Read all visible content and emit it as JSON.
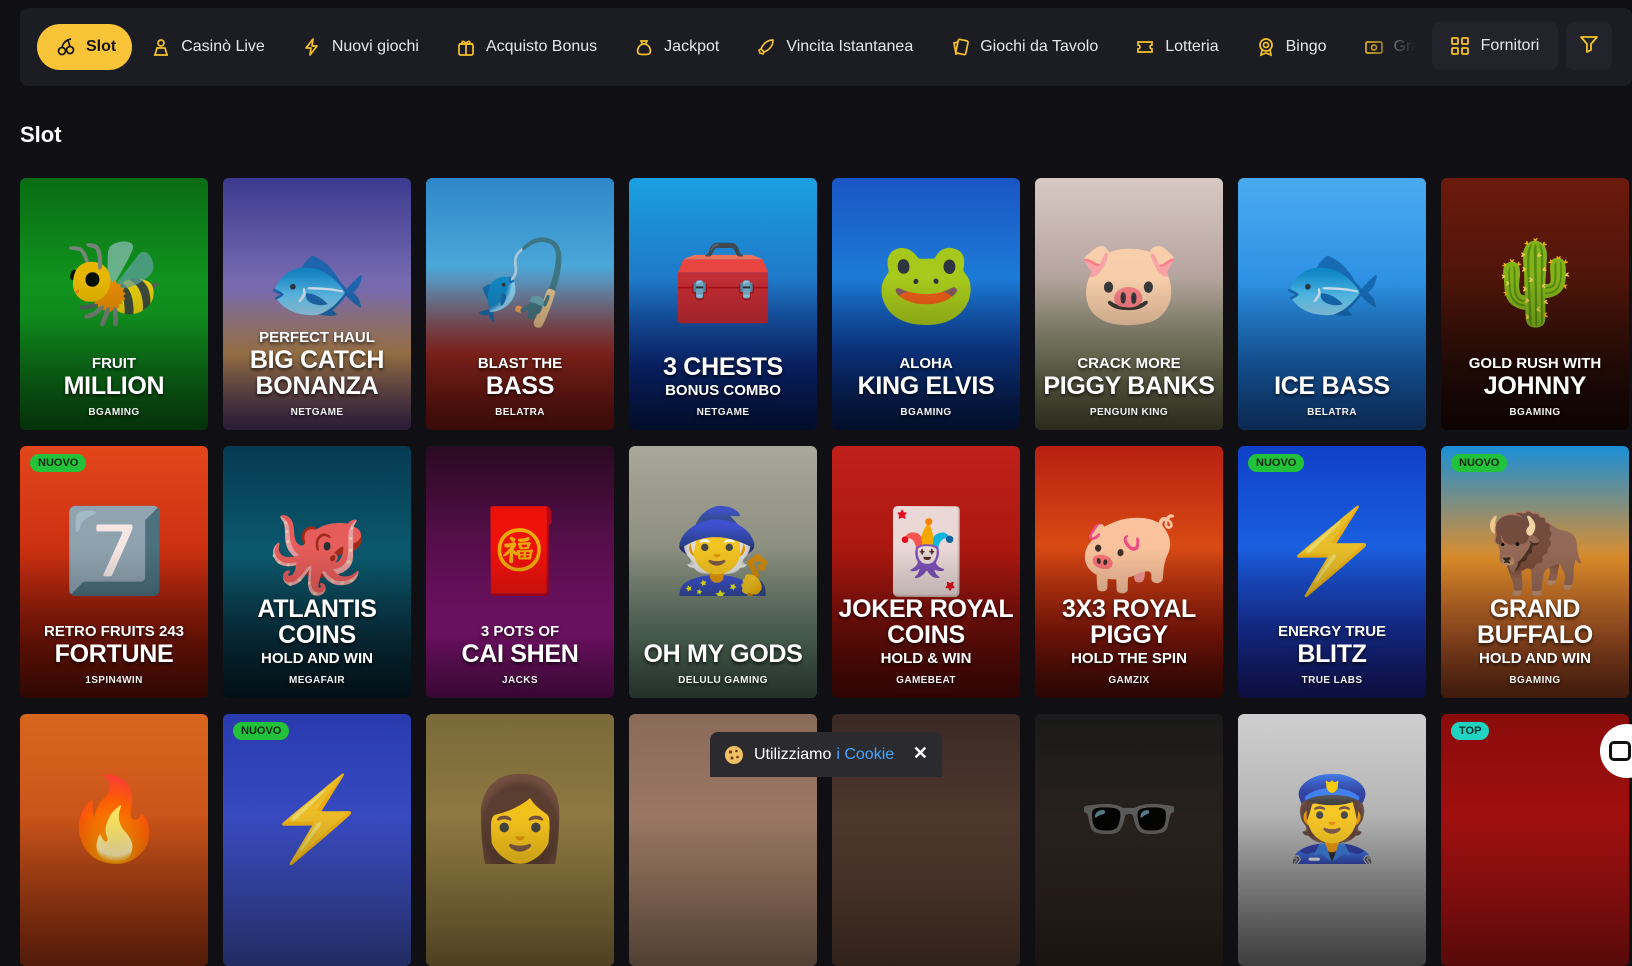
{
  "nav": {
    "items": [
      {
        "label": "Slot",
        "icon": "cherries-icon",
        "active": true
      },
      {
        "label": "Casinò Live",
        "icon": "croupier-icon"
      },
      {
        "label": "Nuovi giochi",
        "icon": "lightning-icon"
      },
      {
        "label": "Acquisto Bonus",
        "icon": "gift-icon"
      },
      {
        "label": "Jackpot",
        "icon": "money-bag-icon"
      },
      {
        "label": "Vincita Istantanea",
        "icon": "rocket-icon"
      },
      {
        "label": "Giochi da Tavolo",
        "icon": "cards-icon"
      },
      {
        "label": "Lotteria",
        "icon": "ticket-icon"
      },
      {
        "label": "Bingo",
        "icon": "bingo-icon"
      },
      {
        "label": "Gratta e Vinci",
        "icon": "scratch-card-icon"
      }
    ],
    "providers_label": "Fornitori",
    "filter_icon": "filter-icon"
  },
  "section_title": "Slot",
  "games": [
    {
      "sub": "FRUIT",
      "main": "MILLION",
      "tag": "",
      "provider": "BGAMING",
      "badge": "",
      "art": "🐝",
      "bg": "linear-gradient(180deg,#0a6c14,#12a021 55%,#0b6c17)"
    },
    {
      "sub": "PERFECT HAUL",
      "main": "BIG CATCH BONANZA",
      "tag": "",
      "provider": "NETGAME",
      "badge": "",
      "art": "🐟",
      "bg": "linear-gradient(180deg,#3b3a8f,#7d6fb4 45%,#c9955a 70%,#5d3d7a)"
    },
    {
      "sub": "BLAST THE",
      "main": "BASS",
      "tag": "",
      "provider": "BELATRA",
      "badge": "",
      "art": "🎣",
      "bg": "linear-gradient(180deg,#2f86c9,#4aa7d8 35%,#a52b22 70%,#7c1813)"
    },
    {
      "sub": "",
      "main": "3 CHESTS",
      "tag": "BONUS COMBO",
      "provider": "NETGAME",
      "badge": "",
      "art": "🧰",
      "bg": "linear-gradient(180deg,#1aa0e0,#1f79c9 40%,#0c2d8a 75%,#061c5c)"
    },
    {
      "sub": "ALOHA",
      "main": "KING ELVIS",
      "tag": "",
      "provider": "BGAMING",
      "badge": "",
      "art": "🐸",
      "bg": "linear-gradient(180deg,#1a55c5,#1c7bd6 40%,#0d3fa0 70%,#071f5a)"
    },
    {
      "sub": "CRACK MORE",
      "main": "PIGGY BANKS",
      "tag": "",
      "provider": "PENGUIN KING",
      "badge": "",
      "art": "🐷",
      "bg": "linear-gradient(180deg,#d8c9c4,#b9a7a3 35%,#8a8c6d 70%,#5f6140)"
    },
    {
      "sub": "",
      "main": "ICE BASS",
      "tag": "",
      "provider": "BELATRA",
      "badge": "",
      "art": "🐟",
      "bg": "linear-gradient(180deg,#4aaaf0,#2b8fe2 45%,#1a6ec8 75%,#1a5cb3)"
    },
    {
      "sub": "GOLD RUSH WITH",
      "main": "JOHNNY",
      "tag": "",
      "provider": "BGAMING",
      "badge": "",
      "art": "🌵",
      "bg": "linear-gradient(180deg,#6c1a0c,#4a1409 45%,#2a0d07 80%,#1d0805)"
    },
    {
      "sub": "RETRO FRUITS 243",
      "main": "FORTUNE",
      "tag": "",
      "provider": "1SPIN4WIN",
      "badge": "NUOVO",
      "art": "7️⃣",
      "bg": "linear-gradient(180deg,#e4461b,#c92e10 45%,#8a1708 80%,#6a1206)"
    },
    {
      "sub": "",
      "main": "ATLANTIS COINS",
      "tag": "HOLD AND WIN",
      "provider": "MEGAFAIR",
      "badge": "",
      "art": "🐙",
      "bg": "linear-gradient(180deg,#063a52,#0a5a6e 45%,#0a3a4c 75%,#05222f)"
    },
    {
      "sub": "3 POTS OF",
      "main": "CAI SHEN",
      "tag": "",
      "provider": "JACKS",
      "badge": "",
      "art": "🧧",
      "bg": "linear-gradient(180deg,#2a0a22,#5e0f52 45%,#9a178b 75%,#7a1270)"
    },
    {
      "sub": "",
      "main": "OH MY GODS",
      "tag": "",
      "provider": "DELULU GAMING",
      "badge": "",
      "art": "🧙",
      "bg": "linear-gradient(180deg,#a9a89a,#8d8f80 40%,#65826f 75%,#4f6d5c)"
    },
    {
      "sub": "",
      "main": "JOKER ROYAL COINS",
      "tag": "HOLD & WIN",
      "provider": "GAMEBEAT",
      "badge": "",
      "art": "🃏",
      "bg": "linear-gradient(180deg,#c0201a,#a8170f 45%,#7b0f0a 80%,#640b07)"
    },
    {
      "sub": "",
      "main": "3X3 ROYAL PIGGY",
      "tag": "HOLD THE SPIN",
      "provider": "GAMZIX",
      "badge": "",
      "art": "🐖",
      "bg": "linear-gradient(180deg,#b81f12,#d94a13 40%,#9c1a0c 75%,#5a0d06)"
    },
    {
      "sub": "ENERGY TRUE",
      "main": "BLITZ",
      "tag": "",
      "provider": "TRUE LABS",
      "badge": "NUOVO",
      "art": "⚡",
      "bg": "linear-gradient(180deg,#1040c8,#1a5fe0 40%,#1a35b0 75%,#1e1f8a)"
    },
    {
      "sub": "",
      "main": "GRAND BUFFALO",
      "tag": "HOLD AND WIN",
      "provider": "BGAMING",
      "badge": "NUOVO",
      "art": "🦬",
      "bg": "linear-gradient(180deg,#1a8fd8,#e08e2a 45%,#c1612a 75%,#8a3a1a)"
    },
    {
      "sub": "",
      "main": "",
      "tag": "",
      "provider": "",
      "badge": "",
      "art": "🔥",
      "bg": "linear-gradient(180deg,#d9661e,#b53b14)"
    },
    {
      "sub": "",
      "main": "",
      "tag": "",
      "provider": "",
      "badge": "NUOVO",
      "art": "⚡",
      "bg": "linear-gradient(180deg,#2a3bb0,#4a5ed6)"
    },
    {
      "sub": "",
      "main": "",
      "tag": "",
      "provider": "",
      "badge": "",
      "art": "👩",
      "bg": "linear-gradient(180deg,#7a6a3a,#a88e4a)"
    },
    {
      "sub": "",
      "main": "",
      "tag": "",
      "provider": "",
      "badge": "",
      "art": "",
      "bg": "linear-gradient(180deg,#8a6a5a,#b08a70)"
    },
    {
      "sub": "",
      "main": "",
      "tag": "",
      "provider": "",
      "badge": "",
      "art": "",
      "bg": "linear-gradient(180deg,#3a2a24,#6a4a3a)"
    },
    {
      "sub": "",
      "main": "",
      "tag": "",
      "provider": "",
      "badge": "",
      "art": "🕶️",
      "bg": "linear-gradient(180deg,#1a1a1a,#3a2a20)"
    },
    {
      "sub": "",
      "main": "",
      "tag": "",
      "provider": "",
      "badge": "",
      "art": "👮",
      "bg": "linear-gradient(180deg,#cfcfcf,#8a8a8a)"
    },
    {
      "sub": "",
      "main": "",
      "tag": "",
      "provider": "",
      "badge": "TOP",
      "art": "",
      "bg": "linear-gradient(180deg,#8a0b0b,#c01515)"
    }
  ],
  "cookie": {
    "text": "Utilizziamo",
    "link": "i Cookie",
    "close": "✕"
  },
  "colors": {
    "accent": "#f9c437",
    "background": "#101014",
    "nav_bg": "#1c1d23",
    "badge_new": "#22c33a",
    "badge_top": "#21d3c1",
    "link": "#42a5ff"
  }
}
